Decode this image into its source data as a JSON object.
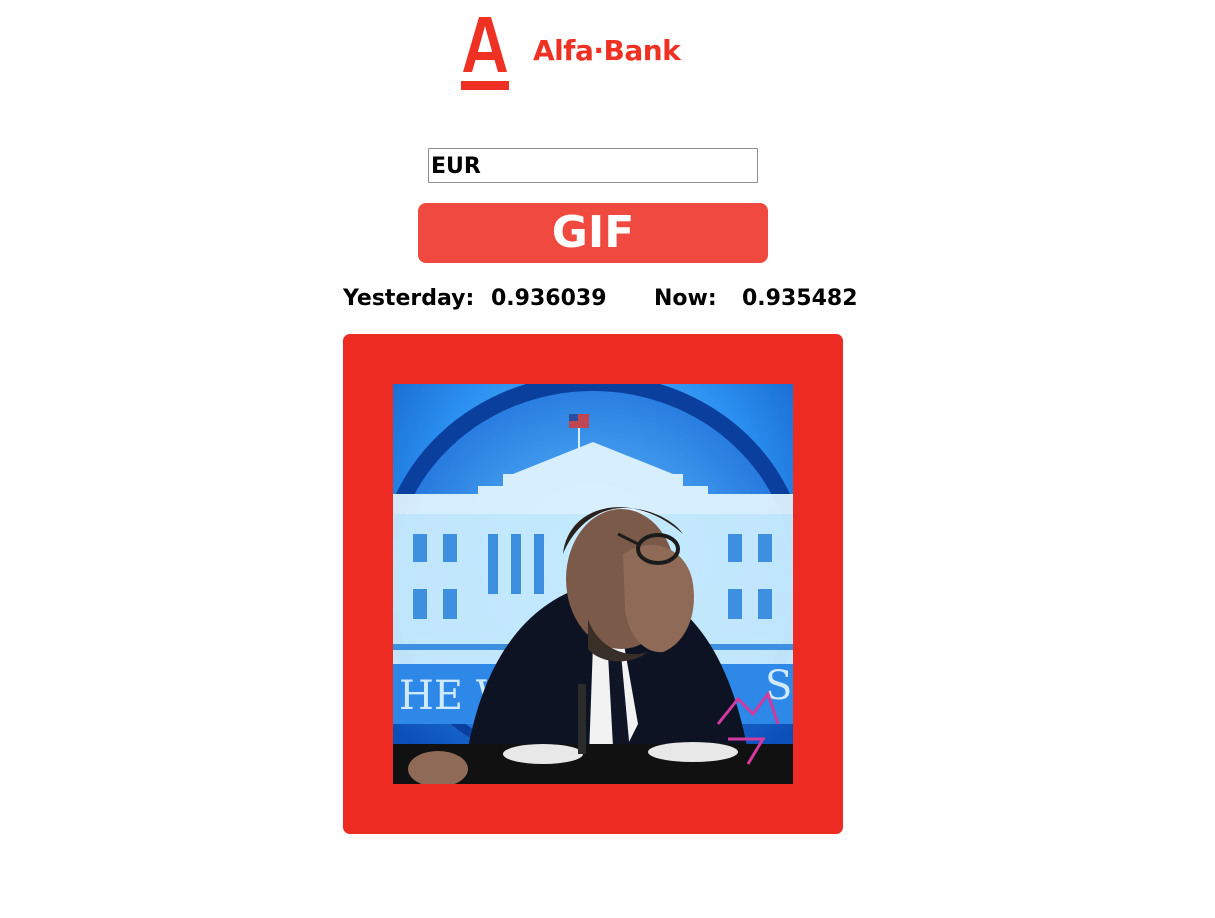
{
  "brand": {
    "name": "Alfa·Bank",
    "logo_icon": "alfa-a-logo-icon",
    "color": "#ef3124"
  },
  "currency_input": {
    "value": "EUR",
    "placeholder": ""
  },
  "gif_button": {
    "label": "GIF",
    "color": "#f04a40"
  },
  "rates": {
    "yesterday_label": "Yesterday:",
    "yesterday_value": "0.936039",
    "now_label": "Now:",
    "now_value": "0.935482"
  },
  "gif_frame": {
    "border_color": "#ee2b22",
    "image_description_icon": "facepalm-gif-image"
  }
}
